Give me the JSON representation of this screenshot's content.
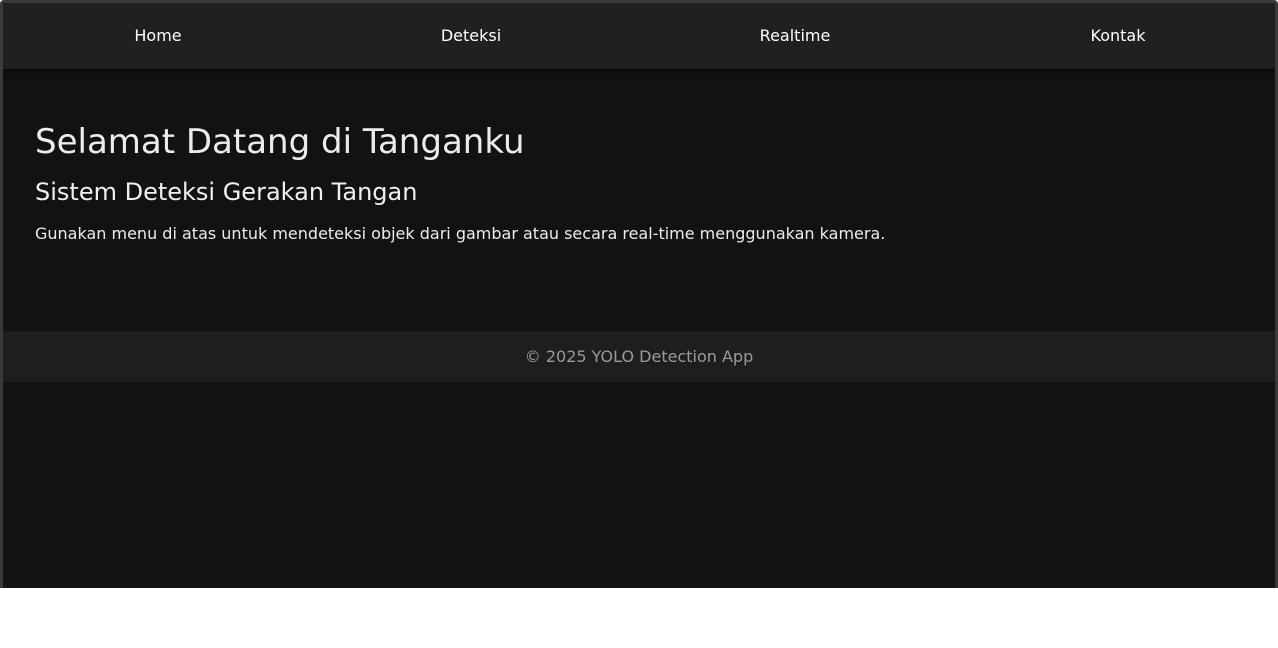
{
  "nav": {
    "items": [
      {
        "label": "Home"
      },
      {
        "label": "Deteksi"
      },
      {
        "label": "Realtime"
      },
      {
        "label": "Kontak"
      }
    ]
  },
  "main": {
    "title": "Selamat Datang di Tanganku",
    "subtitle": "Sistem Deteksi Gerakan Tangan",
    "description": "Gunakan menu di atas untuk mendeteksi objek dari gambar atau secara real-time menggunakan kamera."
  },
  "footer": {
    "text": "© 2025 YOLO Detection App"
  },
  "colors": {
    "background": "#121212",
    "navbar": "#202020",
    "footer": "#1e1e1e",
    "text": "#ececec",
    "footer_text": "#9a9a9a"
  }
}
